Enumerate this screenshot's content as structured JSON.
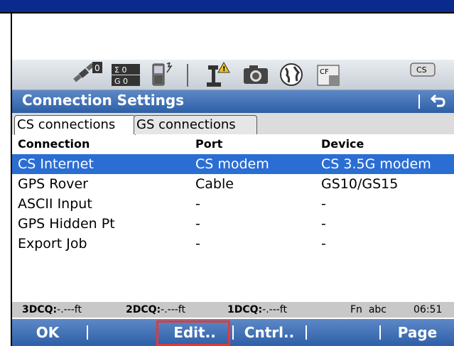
{
  "window": {
    "title": "Connection Settings",
    "back_icon": "back-arrow-icon"
  },
  "status_icons": [
    {
      "name": "satellite-icon",
      "text": "0"
    },
    {
      "name": "sigma-counter-icon",
      "line1": "Σ 0",
      "line2": "G 0"
    },
    {
      "name": "device-battery-icon",
      "text": ""
    },
    {
      "name": "radio-warning-icon",
      "text": ""
    },
    {
      "name": "camera-icon",
      "text": ""
    },
    {
      "name": "globe-icon",
      "text": ""
    },
    {
      "name": "cf-card-icon",
      "text": "CF"
    },
    {
      "name": "cs-device-icon",
      "text": "CS"
    }
  ],
  "tabs": [
    {
      "label": "CS connections",
      "active": true
    },
    {
      "label": "GS connections",
      "active": false
    }
  ],
  "table": {
    "headers": [
      "Connection",
      "Port",
      "Device"
    ],
    "rows": [
      {
        "connection": "CS Internet",
        "port": "CS modem",
        "device": "CS 3.5G modem",
        "selected": true
      },
      {
        "connection": "GPS Rover",
        "port": "Cable",
        "device": "GS10/GS15",
        "selected": false
      },
      {
        "connection": "ASCII Input",
        "port": "-",
        "device": "-",
        "selected": false
      },
      {
        "connection": "GPS Hidden Pt",
        "port": "-",
        "device": "-",
        "selected": false
      },
      {
        "connection": "Export Job",
        "port": "-",
        "device": "-",
        "selected": false
      }
    ]
  },
  "infobar": {
    "q3_label": "3DCQ:",
    "q3_value": "-.---ft",
    "q2_label": "2DCQ:",
    "q2_value": "-.---ft",
    "q1_label": "1DCQ:",
    "q1_value": "-.---ft",
    "mode": "Fn  abc",
    "time": "06:51"
  },
  "softkeys": {
    "ok": "OK",
    "edit": "Edit..",
    "cntrl": "Cntrl..",
    "page": "Page"
  },
  "colors": {
    "accent": "#2d5fa7",
    "selection": "#2b6ed3",
    "highlight": "#e53935"
  }
}
